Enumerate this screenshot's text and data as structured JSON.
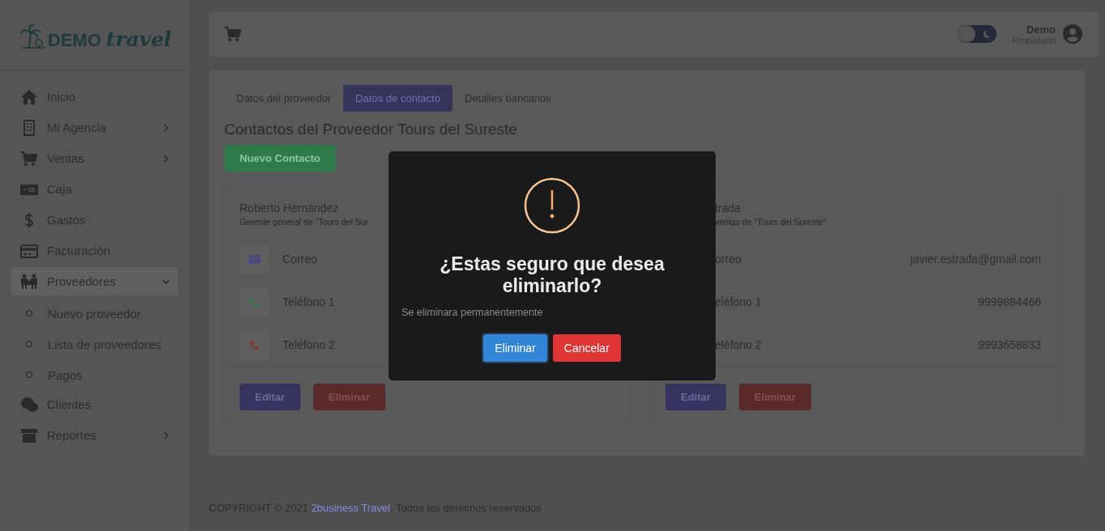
{
  "sidebar": {
    "logo": {
      "word_1": "DEMO",
      "word_2": "travel"
    },
    "items": [
      {
        "label": "Inicio",
        "kind": "home",
        "submenu": false
      },
      {
        "label": "Mi Agencia",
        "kind": "building",
        "submenu": true,
        "expanded": false
      },
      {
        "label": "Ventas",
        "kind": "cart",
        "submenu": true,
        "expanded": false
      },
      {
        "label": "Caja",
        "kind": "cash",
        "submenu": false
      },
      {
        "label": "Gastos",
        "kind": "dollar",
        "submenu": false
      },
      {
        "label": "Facturación",
        "kind": "card",
        "submenu": false
      },
      {
        "label": "Proveedores",
        "kind": "people",
        "submenu": true,
        "expanded": true,
        "children": [
          "Nuevo proveedor",
          "Lista de proveedores",
          "Pagos"
        ]
      },
      {
        "label": "Clientes",
        "kind": "chat",
        "submenu": false
      },
      {
        "label": "Reportes",
        "kind": "archive",
        "submenu": true,
        "expanded": false
      }
    ]
  },
  "topbar": {
    "dark_mode": false,
    "user_name": "Demo",
    "user_role": "Propietario"
  },
  "tabs": [
    {
      "label": "Datos del proveedor",
      "selected": false
    },
    {
      "label": "Datos de contacto",
      "selected": true
    },
    {
      "label": "Detalles bancarios",
      "selected": false
    }
  ],
  "title": "Contactos del Proveedor Tours del Sureste",
  "new_contact_button": "Nuevo Contacto",
  "contacts": [
    {
      "name": "Roberto Hernández",
      "subtitle": "Gerente general de \"Tours del Sur",
      "cut": false,
      "rows": [
        {
          "kind": "mail",
          "color": "#4a4780",
          "label": "Correo"
        },
        {
          "kind": "phone",
          "color": "#2e7d4a",
          "label": "Teléfono 1"
        },
        {
          "kind": "phone",
          "color": "#8a3232",
          "label": "Teléfono 2"
        }
      ],
      "edit": "Editar",
      "delete": "Eliminar"
    },
    {
      "name": "trada",
      "subtitle": "ventas de \"Tours del Sureste\"",
      "cut": true,
      "rows": [
        {
          "label": "orreo",
          "value": "javier.estrada@gmail.com"
        },
        {
          "label": "eléfono 1",
          "value": "9999884466"
        },
        {
          "label": "eléfono 2",
          "value": "9993658833"
        }
      ],
      "edit": "Editar",
      "delete": "Eliminar"
    }
  ],
  "footer": {
    "before": "COPYRIGHT © 2021 ",
    "link": "2business Travel",
    "after": ", Todos los derechos reservados"
  },
  "dialog": {
    "title": "¿Estas seguro que desea eliminarlo?",
    "text": "Se eliminara permanentemente",
    "confirm": "Eliminar",
    "cancel": "Cancelar"
  }
}
